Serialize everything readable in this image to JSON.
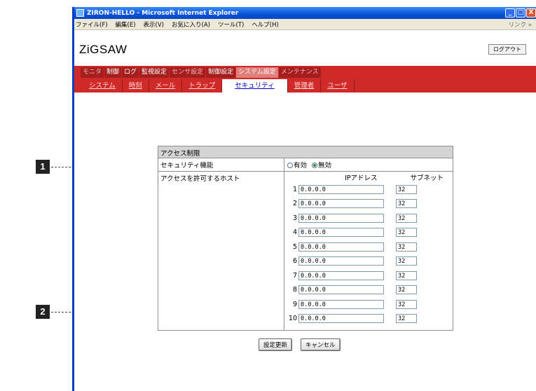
{
  "window": {
    "title": "ZIRON-HELLO - Microsoft Internet Explorer",
    "controls": [
      "_",
      "□",
      "X"
    ]
  },
  "menubar": {
    "items": [
      "ファイル(F)",
      "編集(E)",
      "表示(V)",
      "お気に入り(A)",
      "ツール(T)",
      "ヘルプ(H)"
    ],
    "links": "リンク »"
  },
  "header": {
    "brand": "ZiGSAW",
    "logout": "ログアウト"
  },
  "main_nav": {
    "items": [
      "モニタ",
      "制御",
      "ログ",
      "監視設定",
      "センサ設定",
      "制御設定",
      "システム設定",
      "メンテナンス"
    ],
    "active": "システム設定"
  },
  "sub_nav": {
    "items": [
      "システム",
      "時刻",
      "メール",
      "トラップ",
      "セキュリティ",
      "管理者",
      "ユーザ"
    ],
    "active": "セキュリティ"
  },
  "panel": {
    "title": "アクセス制限",
    "security_label": "セキュリティ機能",
    "enable_label": "有効",
    "disable_label": "無効",
    "selected": "無効",
    "hosts_label": "アクセスを許可するホスト",
    "ip_header": "IPアドレス",
    "subnet_header": "サブネット",
    "hosts": [
      {
        "n": "1",
        "ip": "0.0.0.0",
        "subnet": "32"
      },
      {
        "n": "2",
        "ip": "0.0.0.0",
        "subnet": "32"
      },
      {
        "n": "3",
        "ip": "0.0.0.0",
        "subnet": "32"
      },
      {
        "n": "4",
        "ip": "0.0.0.0",
        "subnet": "32"
      },
      {
        "n": "5",
        "ip": "0.0.0.0",
        "subnet": "32"
      },
      {
        "n": "6",
        "ip": "0.0.0.0",
        "subnet": "32"
      },
      {
        "n": "7",
        "ip": "0.0.0.0",
        "subnet": "32"
      },
      {
        "n": "8",
        "ip": "0.0.0.0",
        "subnet": "32"
      },
      {
        "n": "9",
        "ip": "0.0.0.0",
        "subnet": "32"
      },
      {
        "n": "10",
        "ip": "0.0.0.0",
        "subnet": "32"
      }
    ]
  },
  "buttons": {
    "update": "設定更新",
    "cancel": "キャンセル"
  },
  "callouts": [
    "1",
    "2"
  ],
  "colors": {
    "accent_red": "#cf2a27",
    "title_blue": "#0a52d8"
  }
}
